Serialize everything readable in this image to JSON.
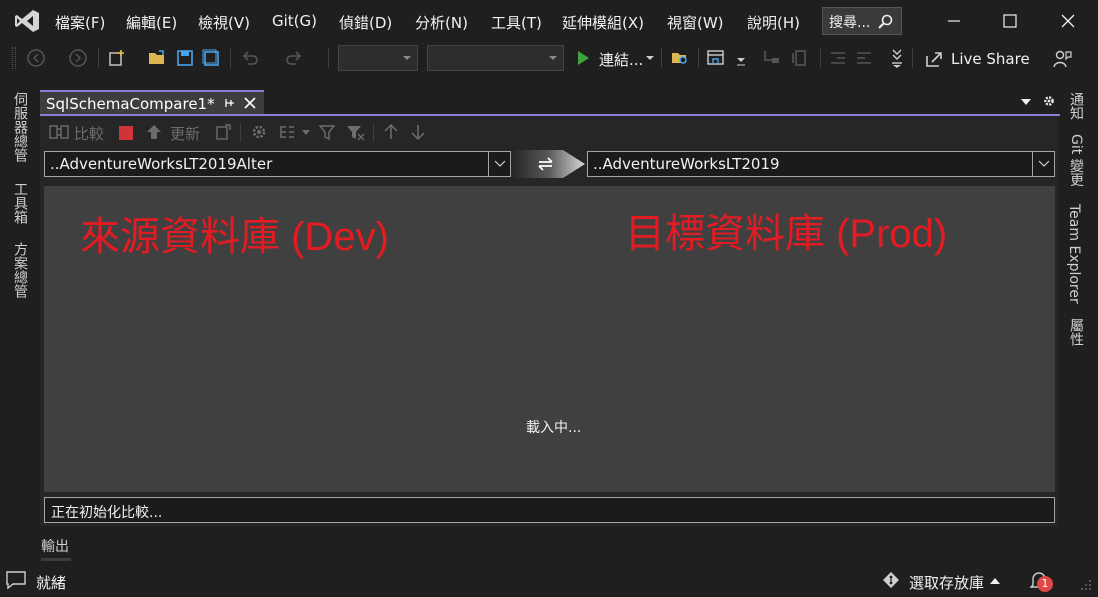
{
  "menu": [
    "檔案(F)",
    "編輯(E)",
    "檢視(V)",
    "Git(G)",
    "偵錯(D)",
    "分析(N)",
    "工具(T)",
    "延伸模組(X)",
    "視窗(W)",
    "說明(H)"
  ],
  "search": {
    "label": "搜尋..."
  },
  "toolbar": {
    "connect_label": "連結...",
    "live_share_label": "Live Share"
  },
  "left_strip": [
    "伺服器總管",
    "工具箱",
    "方案總管"
  ],
  "right_strip": [
    "通知",
    "Git 變更",
    "Team Explorer",
    "屬性"
  ],
  "document_tab": {
    "title": "SqlSchemaCompare1*"
  },
  "editor_toolbar": {
    "compare_label": "比較",
    "update_label": "更新"
  },
  "source_db": {
    "value": "..AdventureWorksLT2019Alter"
  },
  "target_db": {
    "value": "..AdventureWorksLT2019"
  },
  "annotations": {
    "source": "來源資料庫 (Dev)",
    "target": "目標資料庫 (Prod)"
  },
  "loading_text": "載入中...",
  "status_message": "正在初始化比較...",
  "output_label": "輸出",
  "statusbar": {
    "ready": "就緒",
    "repo_label": "選取存放庫",
    "notification_count": "1"
  },
  "colors": {
    "accent": "#8a7fd6",
    "annotation_red": "#e31b23",
    "play_green": "#3ea53e",
    "stop_red": "#d13438",
    "badge_red": "#e04848"
  }
}
